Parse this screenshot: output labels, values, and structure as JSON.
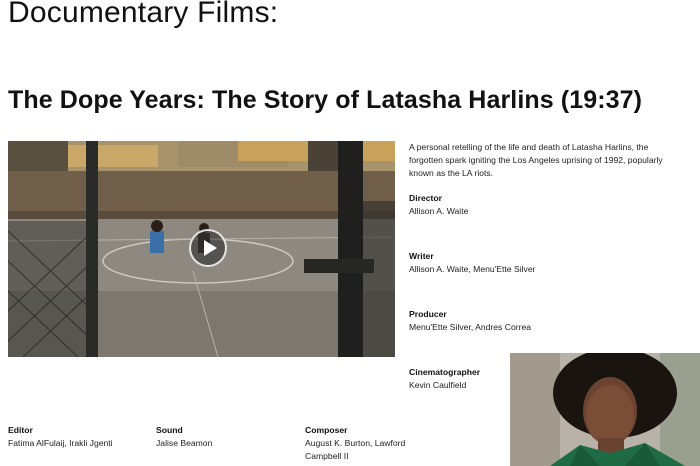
{
  "page": {
    "section_title": "Documentary Films:"
  },
  "film": {
    "title": "The Dope Years: The Story of Latasha Harlins (19:37)",
    "description": "A personal retelling of the life and death of Latasha Harlins, the forgotten spark igniting the Los Angeles uprising of 1992, popularly known as the LA riots.",
    "video": {
      "play_icon": "play-icon"
    },
    "credits": {
      "director": {
        "label": "Director",
        "value": "Allison A. Waite"
      },
      "writer": {
        "label": "Writer",
        "value": "Allison A. Waite, Menu'Ette Silver"
      },
      "producer": {
        "label": "Producer",
        "value": "Menu'Ette Silver, Andres Correa"
      },
      "cinematographer": {
        "label": "Cinematographer",
        "value": "Kevin Caulfield"
      },
      "editor": {
        "label": "Editor",
        "value": "Fatima AlFulaij, Irakli Jgenti"
      },
      "sound": {
        "label": "Sound",
        "value": "Jalise Beamon"
      },
      "composer": {
        "label": "Composer",
        "value": "August K. Burton, Lawford Campbell II"
      }
    }
  }
}
